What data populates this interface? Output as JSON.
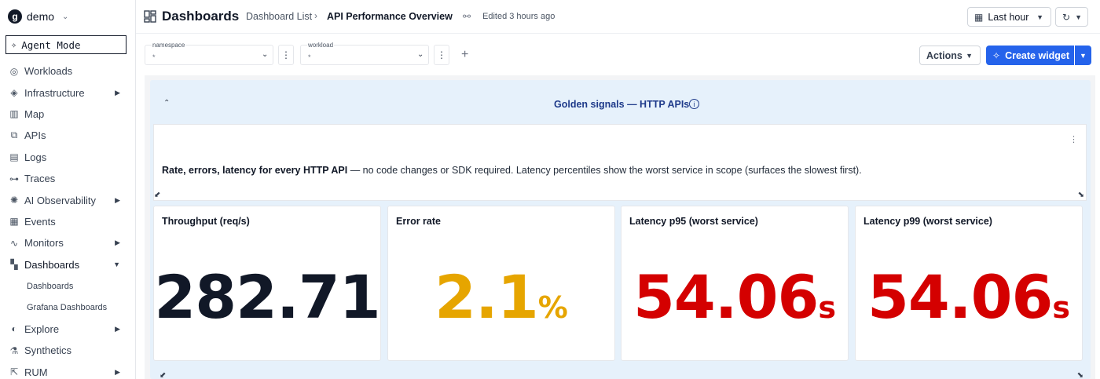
{
  "org": {
    "logo_letter": "g",
    "name": "demo"
  },
  "sidebar": {
    "agent_mode_label": "Agent Mode",
    "items": [
      {
        "label": "Workloads",
        "icon": "workloads-icon",
        "has_submenu": false
      },
      {
        "label": "Infrastructure",
        "icon": "layers-icon",
        "has_submenu": true
      },
      {
        "label": "Map",
        "icon": "map-icon",
        "has_submenu": false
      },
      {
        "label": "APIs",
        "icon": "api-icon",
        "has_submenu": false
      },
      {
        "label": "Logs",
        "icon": "logs-icon",
        "has_submenu": false
      },
      {
        "label": "Traces",
        "icon": "traces-icon",
        "has_submenu": false
      },
      {
        "label": "AI Observability",
        "icon": "ai-icon",
        "has_submenu": true
      },
      {
        "label": "Events",
        "icon": "calendar-icon",
        "has_submenu": false
      },
      {
        "label": "Monitors",
        "icon": "pulse-icon",
        "has_submenu": true
      },
      {
        "label": "Dashboards",
        "icon": "dashboard-icon",
        "has_submenu": true,
        "expanded": true
      },
      {
        "label": "Explore",
        "icon": "compass-icon",
        "has_submenu": true
      },
      {
        "label": "Synthetics",
        "icon": "flask-icon",
        "has_submenu": false
      },
      {
        "label": "RUM",
        "icon": "rum-icon",
        "has_submenu": true
      }
    ],
    "dashboards_sub": [
      "Dashboards",
      "Grafana Dashboards"
    ]
  },
  "header": {
    "title": "Dashboards",
    "breadcrumb_parent": "Dashboard List",
    "breadcrumb_current": "API Performance Overview",
    "edited": "Edited 3 hours ago",
    "time_range": "Last hour"
  },
  "variables": [
    {
      "label": "namespace",
      "value": "*"
    },
    {
      "label": "workload",
      "value": "*"
    }
  ],
  "toolbar": {
    "actions_label": "Actions",
    "create_widget_label": "Create widget"
  },
  "group": {
    "title": "Golden signals — HTTP APIs",
    "text_bold": "Rate, errors, latency for every HTTP API",
    "text_rest": " — no code changes or SDK required. Latency percentiles show the worst service in scope (surfaces the slowest first)."
  },
  "stats": [
    {
      "title": "Throughput (req/s)",
      "value": "282.71",
      "unit": "",
      "color": "#111827"
    },
    {
      "title": "Error rate",
      "value": "2.1",
      "unit": "%",
      "color": "#e6a500"
    },
    {
      "title": "Latency p95 (worst service)",
      "value": "54.06",
      "unit": "s",
      "color": "#d40000"
    },
    {
      "title": "Latency p99 (worst service)",
      "value": "54.06",
      "unit": "s",
      "color": "#d40000"
    }
  ]
}
